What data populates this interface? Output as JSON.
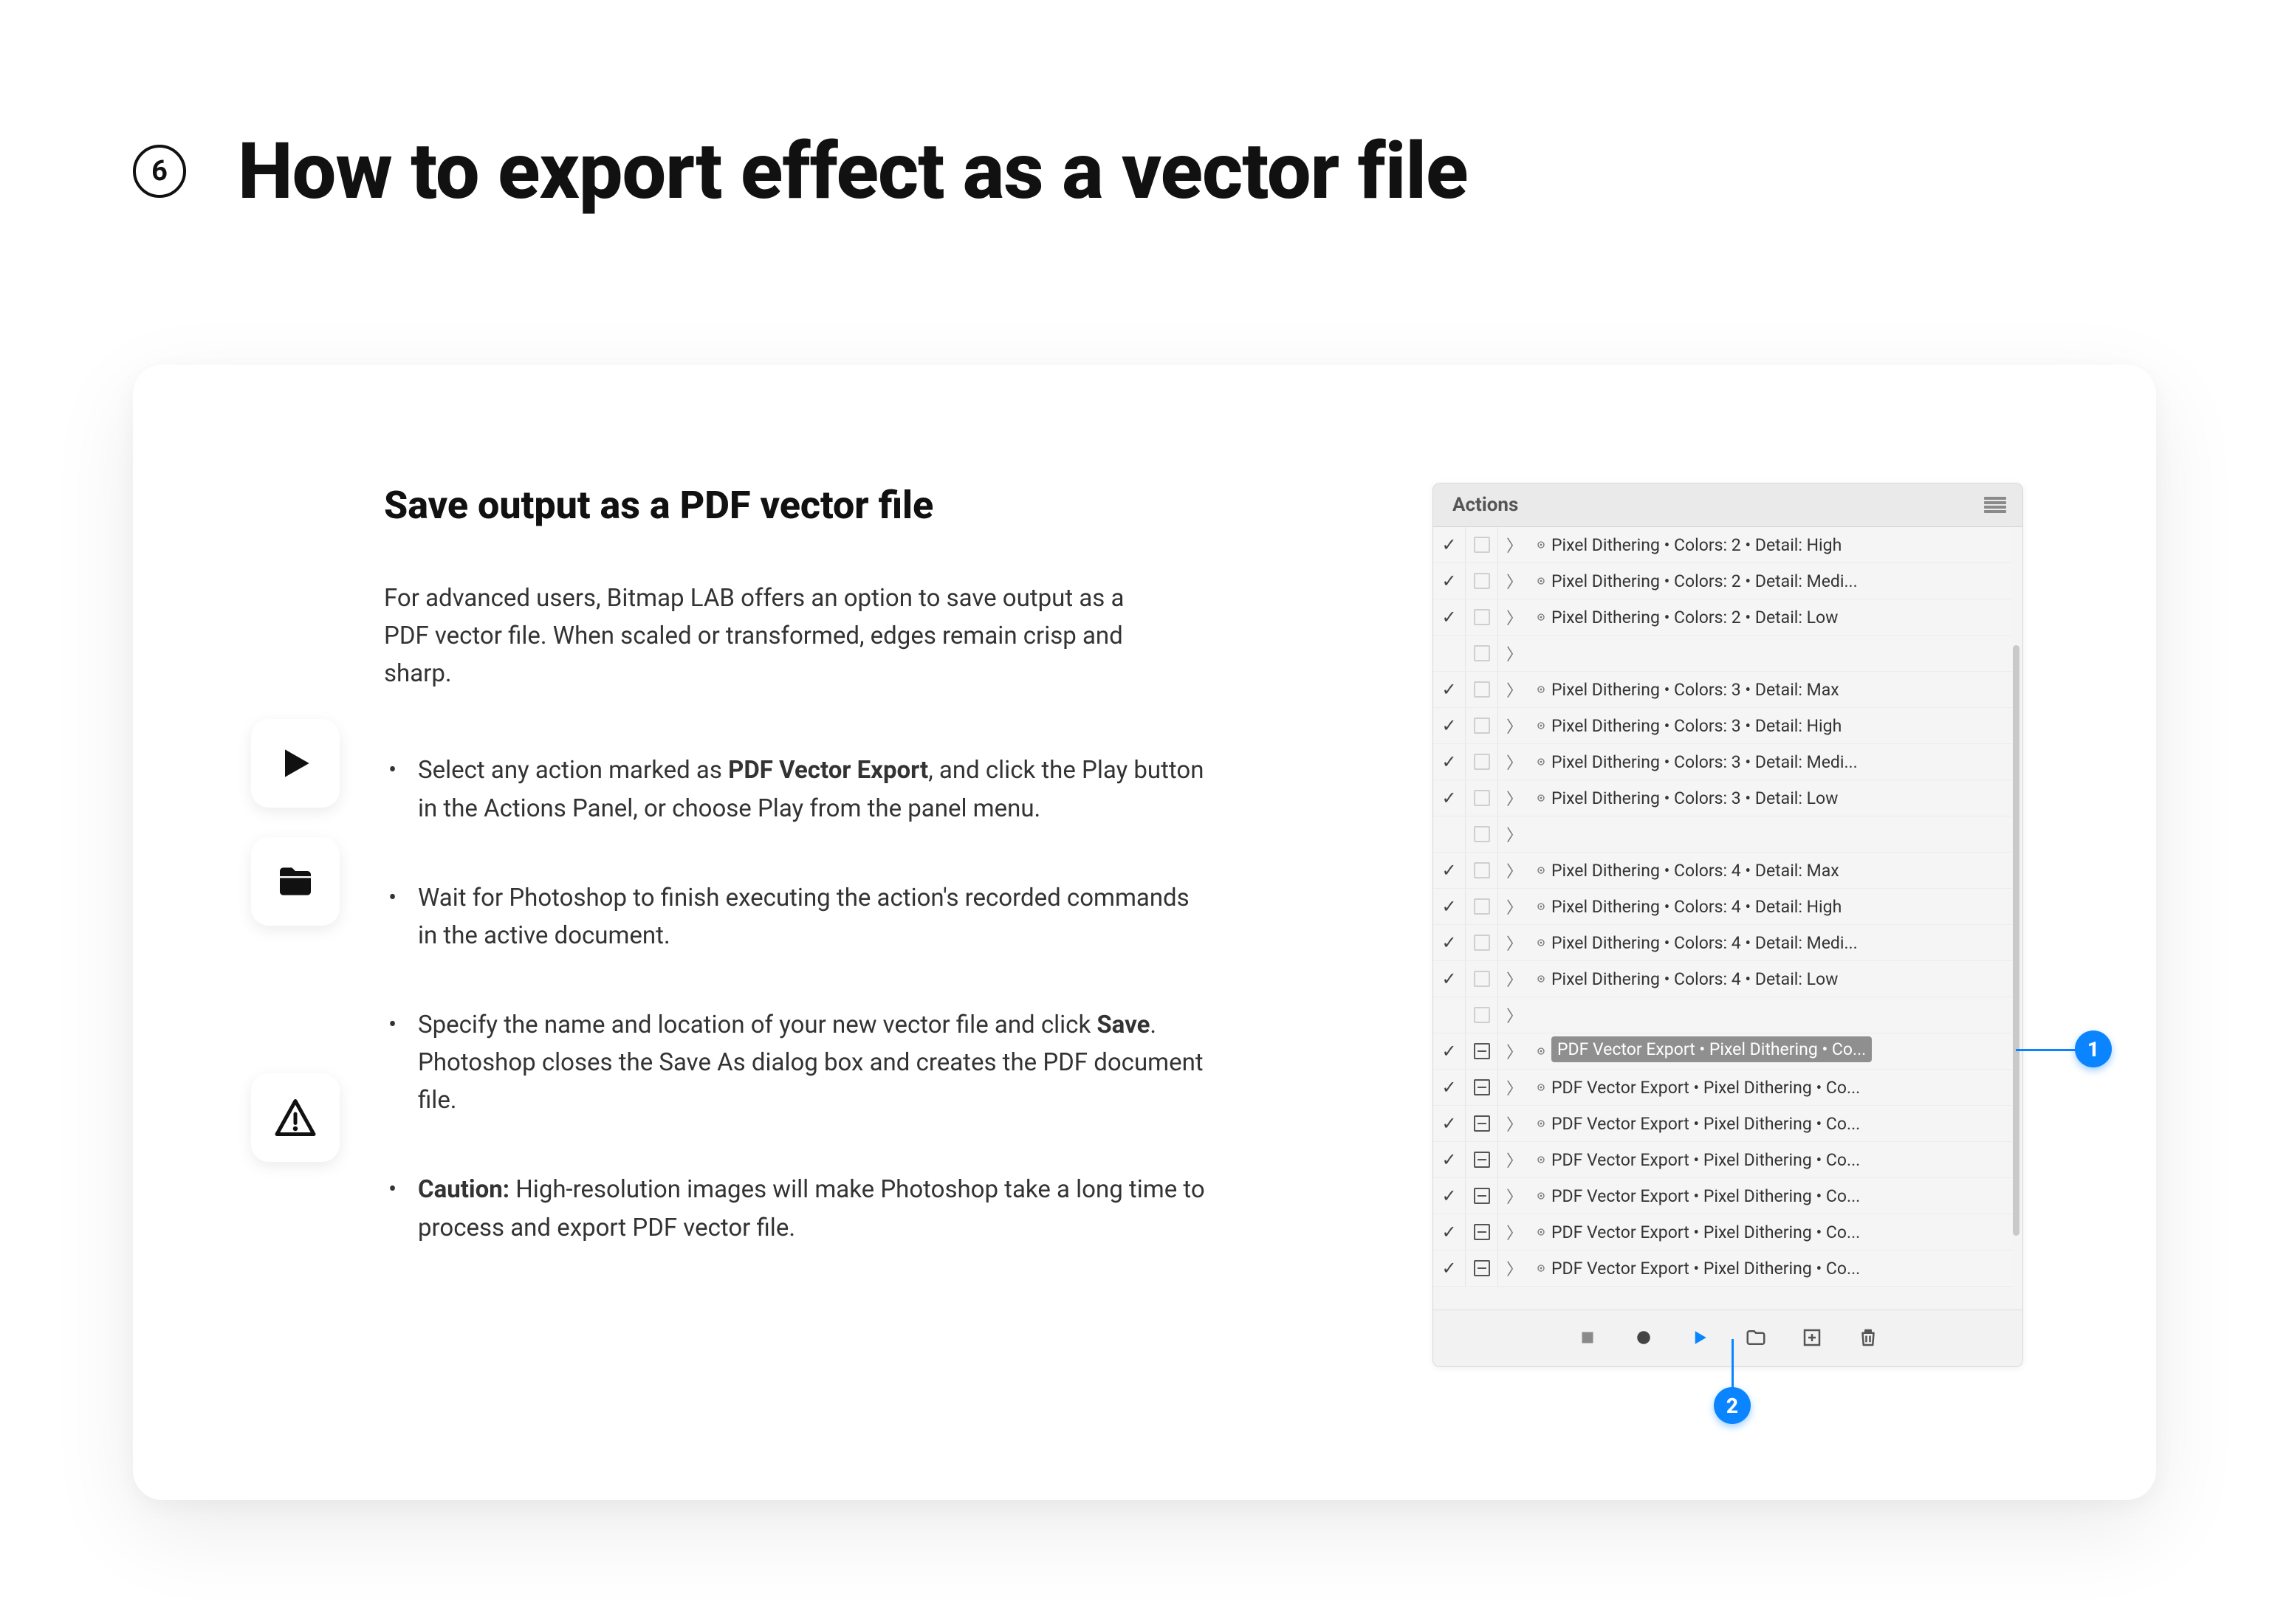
{
  "step_number": "6",
  "page_title": "How to export effect as a vector file",
  "card": {
    "sub_title": "Save output as a PDF vector file",
    "intro": "For advanced users, Bitmap LAB offers an option to save output as a PDF vector file. When scaled or transformed, edges remain crisp and sharp.",
    "steps": {
      "s1_pre": "Select any action marked as ",
      "s1_strong": "PDF Vector Export",
      "s1_post": ", and click the Play button in the Actions Panel, or choose Play from the panel menu.",
      "s2": "Wait for Photoshop to finish executing the action's recorded commands in the active document.",
      "s3_pre": "Specify the name and location of your new vector file and click ",
      "s3_strong": "Save",
      "s3_post": ". Photoshop closes the Save As dialog box and creates the PDF document file.",
      "s4_strong": "Caution:",
      "s4_post": " High-resolution images will make Photoshop take a long time to process and export PDF vector file."
    }
  },
  "panel": {
    "title": "Actions",
    "rows": [
      {
        "check": true,
        "box": "empty",
        "chev": true,
        "badge": true,
        "label": "Pixel Dithering • Colors: 2 • Detail: High",
        "selected": false
      },
      {
        "check": true,
        "box": "empty",
        "chev": true,
        "badge": true,
        "label": "Pixel Dithering • Colors: 2 • Detail: Medi...",
        "selected": false
      },
      {
        "check": true,
        "box": "empty",
        "chev": true,
        "badge": true,
        "label": "Pixel Dithering • Colors: 2 • Detail: Low",
        "selected": false
      },
      {
        "check": false,
        "box": "empty",
        "chev": true,
        "badge": false,
        "label": "",
        "selected": false
      },
      {
        "check": true,
        "box": "empty",
        "chev": true,
        "badge": true,
        "label": "Pixel Dithering • Colors: 3 • Detail: Max",
        "selected": false
      },
      {
        "check": true,
        "box": "empty",
        "chev": true,
        "badge": true,
        "label": "Pixel Dithering • Colors: 3 • Detail: High",
        "selected": false
      },
      {
        "check": true,
        "box": "empty",
        "chev": true,
        "badge": true,
        "label": "Pixel Dithering • Colors: 3 • Detail: Medi...",
        "selected": false
      },
      {
        "check": true,
        "box": "empty",
        "chev": true,
        "badge": true,
        "label": "Pixel Dithering • Colors: 3 • Detail: Low",
        "selected": false
      },
      {
        "check": false,
        "box": "empty",
        "chev": true,
        "badge": false,
        "label": "",
        "selected": false
      },
      {
        "check": true,
        "box": "empty",
        "chev": true,
        "badge": true,
        "label": "Pixel Dithering • Colors: 4 • Detail: Max",
        "selected": false
      },
      {
        "check": true,
        "box": "empty",
        "chev": true,
        "badge": true,
        "label": "Pixel Dithering • Colors: 4 • Detail: High",
        "selected": false
      },
      {
        "check": true,
        "box": "empty",
        "chev": true,
        "badge": true,
        "label": "Pixel Dithering • Colors: 4 • Detail: Medi...",
        "selected": false
      },
      {
        "check": true,
        "box": "empty",
        "chev": true,
        "badge": true,
        "label": "Pixel Dithering • Colors: 4 • Detail: Low",
        "selected": false
      },
      {
        "check": false,
        "box": "empty",
        "chev": true,
        "badge": false,
        "label": "",
        "selected": false
      },
      {
        "check": true,
        "box": "minus",
        "chev": true,
        "badge": true,
        "label": "PDF Vector Export • Pixel Dithering • Co...",
        "selected": true
      },
      {
        "check": true,
        "box": "minus",
        "chev": true,
        "badge": true,
        "label": "PDF Vector Export • Pixel Dithering • Co...",
        "selected": false
      },
      {
        "check": true,
        "box": "minus",
        "chev": true,
        "badge": true,
        "label": "PDF Vector Export • Pixel Dithering • Co...",
        "selected": false
      },
      {
        "check": true,
        "box": "minus",
        "chev": true,
        "badge": true,
        "label": "PDF Vector Export • Pixel Dithering • Co...",
        "selected": false
      },
      {
        "check": true,
        "box": "minus",
        "chev": true,
        "badge": true,
        "label": "PDF Vector Export • Pixel Dithering • Co...",
        "selected": false
      },
      {
        "check": true,
        "box": "minus",
        "chev": true,
        "badge": true,
        "label": "PDF Vector Export • Pixel Dithering • Co...",
        "selected": false
      },
      {
        "check": true,
        "box": "minus",
        "chev": true,
        "badge": true,
        "label": "PDF Vector Export • Pixel Dithering • Co...",
        "selected": false
      }
    ],
    "callouts": {
      "c1": "1",
      "c2": "2"
    }
  },
  "colors": {
    "accent": "#0a84ff"
  }
}
